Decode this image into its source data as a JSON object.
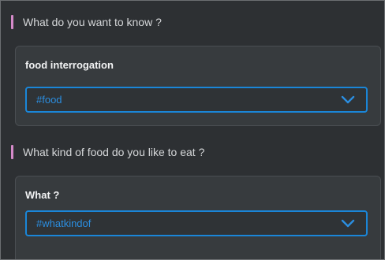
{
  "sections": [
    {
      "question": "What do you want to know ?",
      "field_label": "food interrogation",
      "selected_value": "#food"
    },
    {
      "question": "What kind of food do you like to eat ?",
      "field_label": "What ?",
      "selected_value": "#whatkindof"
    }
  ],
  "colors": {
    "background": "#2d3033",
    "card": "#373b3e",
    "question_marker": "#d48ac9",
    "select_border": "#1a86d8",
    "select_text": "#2b8ee0"
  },
  "icons": {
    "dropdown": "chevron-down-icon"
  }
}
